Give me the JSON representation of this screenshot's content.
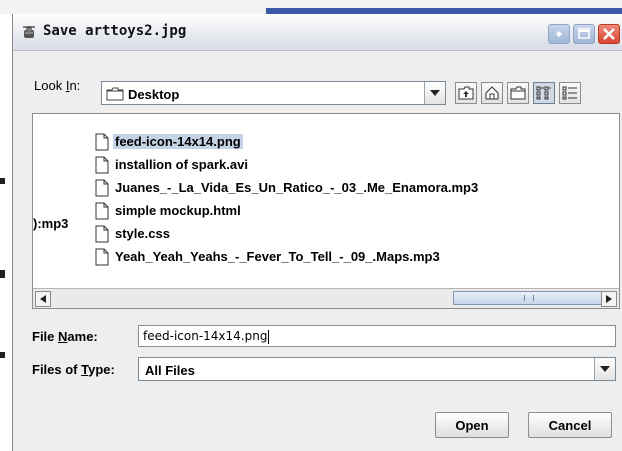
{
  "dialog": {
    "title": "Save arttoys2.jpg",
    "accent_close": "#d6452f",
    "accent_title": "#c9d6ea"
  },
  "look_in": {
    "label_pre": "Look ",
    "label_key": "I",
    "label_post": "n:",
    "value": "Desktop"
  },
  "toolbar": {
    "buttons": [
      {
        "name": "up-one-level-icon"
      },
      {
        "name": "home-icon"
      },
      {
        "name": "new-folder-icon"
      },
      {
        "name": "list-view-icon"
      },
      {
        "name": "details-view-icon"
      }
    ]
  },
  "files": {
    "cutoff_text": "):mp3",
    "items": [
      {
        "name": "feed-icon-14x14.png",
        "selected": true
      },
      {
        "name": "installion of spark.avi"
      },
      {
        "name": "Juanes_-_La_Vida_Es_Un_Ratico_-_03_.Me_Enamora.mp3"
      },
      {
        "name": "simple mockup.html"
      },
      {
        "name": "style.css"
      },
      {
        "name": "Yeah_Yeah_Yeahs_-_Fever_To_Tell_-_09_.Maps.mp3"
      }
    ]
  },
  "file_name": {
    "label_pre": "File ",
    "label_key": "N",
    "label_post": "ame:",
    "value": "feed-icon-14x14.png"
  },
  "file_type": {
    "label_pre": "Files of ",
    "label_key": "T",
    "label_post": "ype:",
    "value": "All Files"
  },
  "buttons": {
    "open": "Open",
    "cancel": "Cancel"
  }
}
